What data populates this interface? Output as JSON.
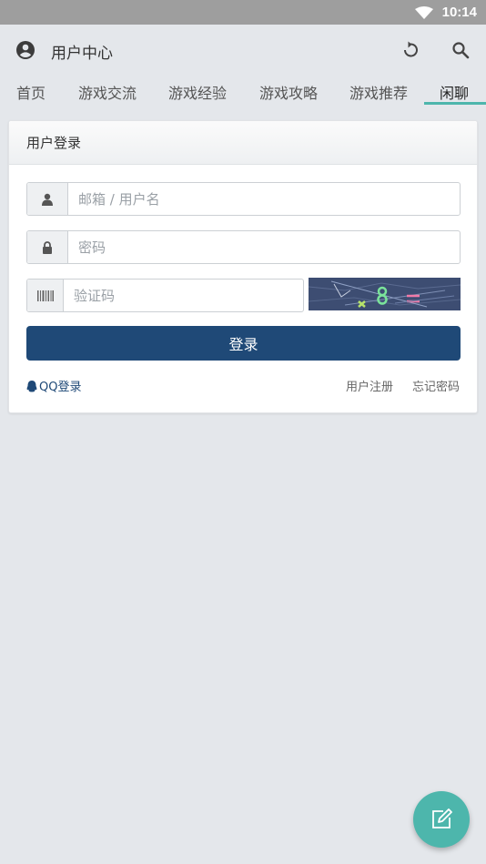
{
  "status": {
    "time": "10:14"
  },
  "appbar": {
    "title": "用户中心"
  },
  "tabs": [
    {
      "label": "首页"
    },
    {
      "label": "游戏交流"
    },
    {
      "label": "游戏经验"
    },
    {
      "label": "游戏攻略"
    },
    {
      "label": "游戏推荐"
    },
    {
      "label": "闲聊",
      "active": true
    }
  ],
  "login": {
    "header": "用户登录",
    "username_placeholder": "邮箱 / 用户名",
    "password_placeholder": "密码",
    "captcha_placeholder": "验证码",
    "submit_label": "登录",
    "qq_label": "QQ登录",
    "register_label": "用户注册",
    "forgot_label": "忘记密码"
  },
  "colors": {
    "accent": "#4db6ac",
    "primary": "#1f4977",
    "background": "#e4e7eb"
  }
}
